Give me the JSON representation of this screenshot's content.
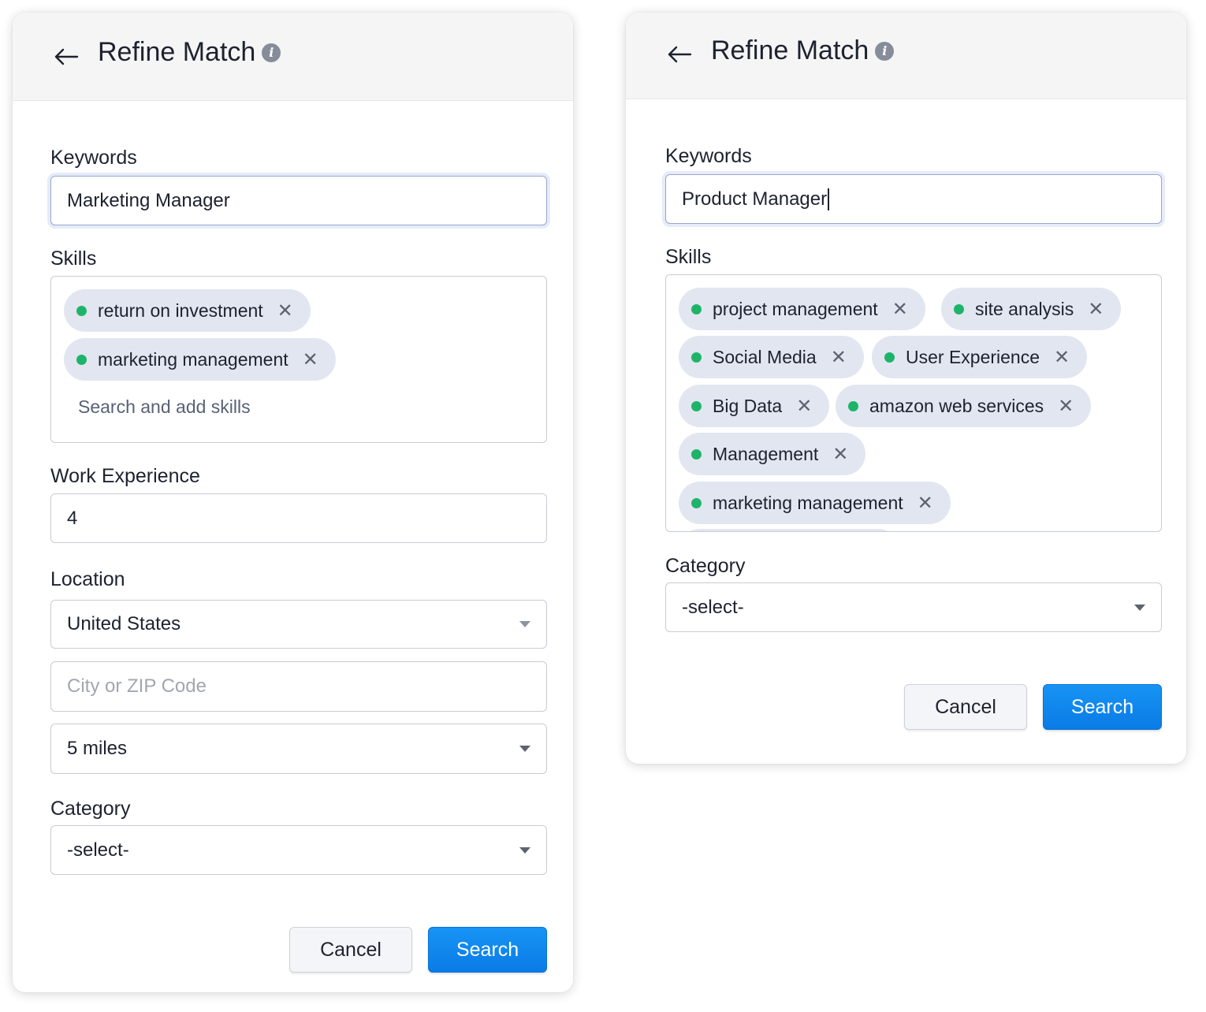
{
  "left_panel": {
    "title": "Refine Match",
    "keywords": {
      "label": "Keywords",
      "value": "Marketing Manager"
    },
    "skills": {
      "label": "Skills",
      "items": [
        "return on investment",
        "marketing management"
      ],
      "search_placeholder": "Search and add skills"
    },
    "work_experience": {
      "label": "Work Experience",
      "value": "4"
    },
    "location": {
      "label": "Location",
      "country": "United States",
      "city_placeholder": "City or ZIP Code",
      "radius": "5 miles"
    },
    "category": {
      "label": "Category",
      "value": "-select-"
    },
    "buttons": {
      "cancel": "Cancel",
      "search": "Search"
    }
  },
  "right_panel": {
    "title": "Refine Match",
    "keywords": {
      "label": "Keywords",
      "value": "Product Manager"
    },
    "skills": {
      "label": "Skills",
      "items": [
        "project management",
        "site analysis",
        "Social Media",
        "User Experience",
        "Big Data",
        "amazon web services",
        "Management",
        "marketing management"
      ]
    },
    "category": {
      "label": "Category",
      "value": "-select-"
    },
    "buttons": {
      "cancel": "Cancel",
      "search": "Search"
    }
  },
  "colors": {
    "chip_dot": "#1db46a",
    "chip_bg": "#e2e6f0",
    "primary_button": "#0a7be6",
    "header_bg": "#f5f5f5"
  },
  "icons": {
    "back": "arrow-left-icon",
    "info": "info-icon",
    "remove": "close-icon",
    "dropdown": "caret-down-icon"
  }
}
